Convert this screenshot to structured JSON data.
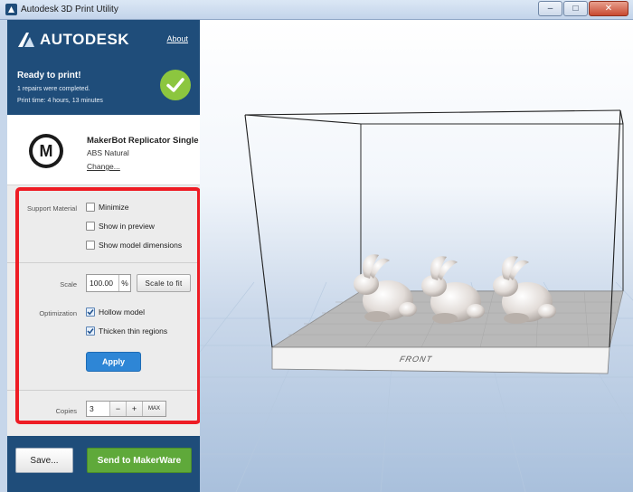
{
  "window": {
    "title": "Autodesk 3D Print Utility",
    "controls": {
      "minimize": "–",
      "maximize": "□",
      "close": "✕"
    }
  },
  "header": {
    "brand": "AUTODESK",
    "about": "About",
    "status_title": "Ready to print!",
    "status_repairs": "1 repairs were completed.",
    "status_time": "Print time: 4 hours, 13 minutes"
  },
  "printer": {
    "logo_letter": "M",
    "name": "MakerBot Replicator Single",
    "material": "ABS Natural",
    "change": "Change..."
  },
  "support": {
    "label": "Support Material",
    "options": [
      {
        "label": "Minimize",
        "checked": false
      },
      {
        "label": "Show in preview",
        "checked": false
      },
      {
        "label": "Show model dimensions",
        "checked": false
      }
    ]
  },
  "scale": {
    "label": "Scale",
    "value": "100.00",
    "unit": "%",
    "fit_button": "Scale to fit"
  },
  "optimization": {
    "label": "Optimization",
    "options": [
      {
        "label": "Hollow model",
        "checked": true
      },
      {
        "label": "Thicken thin regions",
        "checked": true
      }
    ],
    "apply": "Apply"
  },
  "copies": {
    "label": "Copies",
    "value": "3",
    "decrement": "−",
    "increment": "+",
    "max": "MAX"
  },
  "footer": {
    "save": "Save...",
    "send": "Send to MakerWare"
  },
  "viewport": {
    "front_label": "FRONT",
    "model_count": 3,
    "model": "bunny"
  },
  "colors": {
    "header_blue": "#1f4d7a",
    "success_green": "#8cc63f",
    "send_green": "#5fa93a",
    "apply_blue": "#2e86d6",
    "highlight_red": "#ee1c24"
  }
}
